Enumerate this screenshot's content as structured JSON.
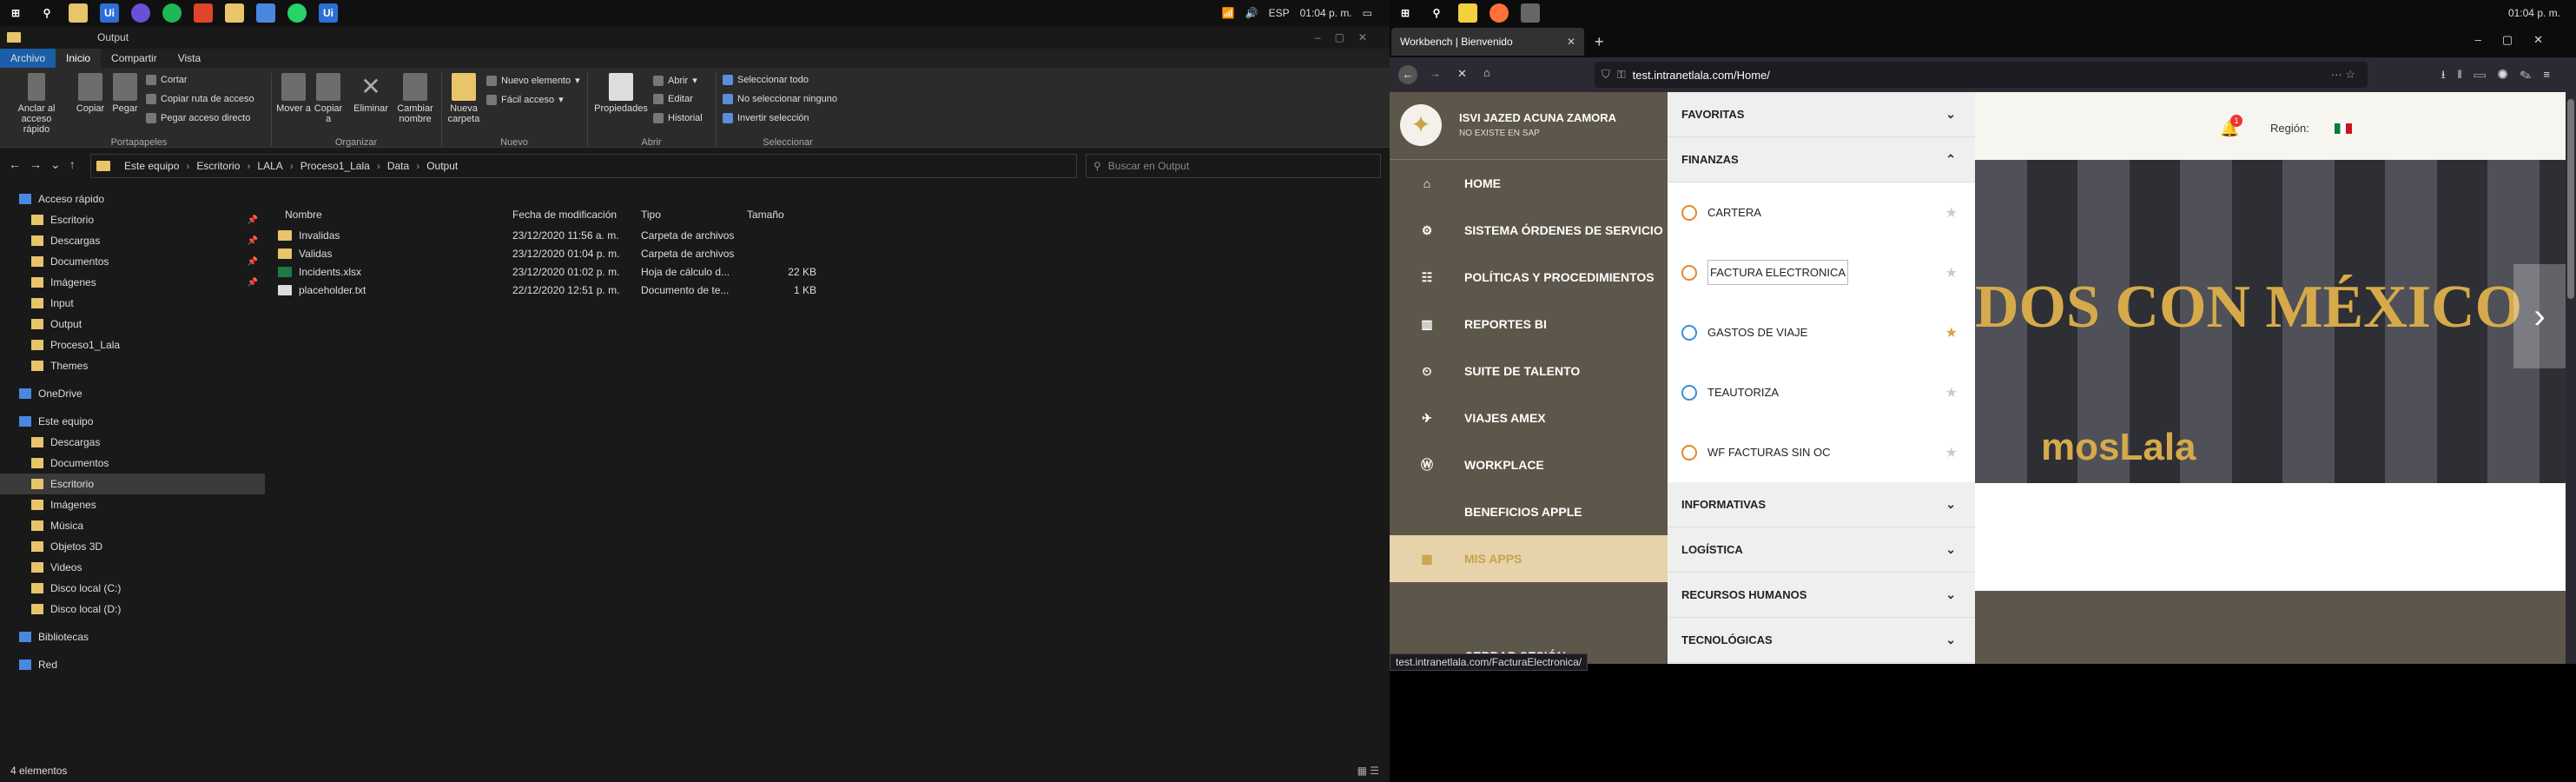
{
  "left_taskbar": {
    "time": "01:04 p. m.",
    "lang": "ESP"
  },
  "right_taskbar": {
    "time": "01:04 p. m."
  },
  "explorer": {
    "title": "Output",
    "tabs": [
      "Archivo",
      "Inicio",
      "Compartir",
      "Vista"
    ],
    "ribbon": {
      "pin": "Anclar al acceso rápido",
      "copy": "Copiar",
      "paste": "Pegar",
      "cut": "Cortar",
      "copy_path": "Copiar ruta de acceso",
      "paste_shortcut": "Pegar acceso directo",
      "move": "Mover a",
      "copy_to": "Copiar a",
      "delete": "Eliminar",
      "rename": "Cambiar nombre",
      "new_folder": "Nueva carpeta",
      "new_item": "Nuevo elemento",
      "easy_access": "Fácil acceso",
      "properties": "Propiedades",
      "open": "Abrir",
      "edit": "Editar",
      "history": "Historial",
      "select_all": "Seleccionar todo",
      "select_none": "No seleccionar ninguno",
      "invert": "Invertir selección",
      "groups": [
        "Portapapeles",
        "Organizar",
        "Nuevo",
        "Abrir",
        "Seleccionar"
      ]
    },
    "breadcrumb": [
      "Este equipo",
      "Escritorio",
      "LALA",
      "Proceso1_Lala",
      "Data",
      "Output"
    ],
    "search_placeholder": "Buscar en Output",
    "nav": [
      {
        "label": "Acceso rápido",
        "pinned": false,
        "indent": 1
      },
      {
        "label": "Escritorio",
        "pinned": true,
        "indent": 2
      },
      {
        "label": "Descargas",
        "pinned": true,
        "indent": 2
      },
      {
        "label": "Documentos",
        "pinned": true,
        "indent": 2
      },
      {
        "label": "Imágenes",
        "pinned": true,
        "indent": 2
      },
      {
        "label": "Input",
        "pinned": false,
        "indent": 2
      },
      {
        "label": "Output",
        "pinned": false,
        "indent": 2
      },
      {
        "label": "Proceso1_Lala",
        "pinned": false,
        "indent": 2
      },
      {
        "label": "Themes",
        "pinned": false,
        "indent": 2
      },
      {
        "label": "OneDrive",
        "pinned": false,
        "indent": 1
      },
      {
        "label": "Este equipo",
        "pinned": false,
        "indent": 1
      },
      {
        "label": "Descargas",
        "pinned": false,
        "indent": 2
      },
      {
        "label": "Documentos",
        "pinned": false,
        "indent": 2
      },
      {
        "label": "Escritorio",
        "pinned": false,
        "indent": 2
      },
      {
        "label": "Imágenes",
        "pinned": false,
        "indent": 2
      },
      {
        "label": "Música",
        "pinned": false,
        "indent": 2
      },
      {
        "label": "Objetos 3D",
        "pinned": false,
        "indent": 2
      },
      {
        "label": "Videos",
        "pinned": false,
        "indent": 2
      },
      {
        "label": "Disco local (C:)",
        "pinned": false,
        "indent": 2
      },
      {
        "label": "Disco local (D:)",
        "pinned": false,
        "indent": 2
      },
      {
        "label": "Bibliotecas",
        "pinned": false,
        "indent": 1
      },
      {
        "label": "Red",
        "pinned": false,
        "indent": 1
      }
    ],
    "columns": [
      "Nombre",
      "Fecha de modificación",
      "Tipo",
      "Tamaño"
    ],
    "files": [
      {
        "name": "Invalidas",
        "date": "23/12/2020 11:56 a. m.",
        "type": "Carpeta de archivos",
        "size": "",
        "kind": "folder"
      },
      {
        "name": "Validas",
        "date": "23/12/2020 01:04 p. m.",
        "type": "Carpeta de archivos",
        "size": "",
        "kind": "folder"
      },
      {
        "name": "Incidents.xlsx",
        "date": "23/12/2020 01:02 p. m.",
        "type": "Hoja de cálculo d...",
        "size": "22 KB",
        "kind": "xlsx"
      },
      {
        "name": "placeholder.txt",
        "date": "22/12/2020 12:51 p. m.",
        "type": "Documento de te...",
        "size": "1 KB",
        "kind": "txt"
      }
    ],
    "status": "4 elementos"
  },
  "firefox": {
    "tab_title": "Workbench | Bienvenido",
    "url": "test.intranetlala.com/Home/",
    "status_url": "test.intranetlala.com/FacturaElectronica/",
    "user_name": "ISVI JAZED ACUNA ZAMORA",
    "user_sub": "NO EXISTE EN SAP",
    "menu": [
      "HOME",
      "SISTEMA ÓRDENES DE SERVICIO",
      "POLÍTICAS Y PROCEDIMIENTOS",
      "REPORTES BI",
      "SUITE DE TALENTO",
      "VIAJES AMEX",
      "WORKPLACE",
      "BENEFICIOS APPLE",
      "MIS APPS",
      "CERRAR SESIÓN"
    ],
    "accordion_top": [
      "FAVORITAS",
      "FINANZAS"
    ],
    "finanzas_items": [
      {
        "label": "CARTERA",
        "fav": false
      },
      {
        "label": "FACTURA ELECTRONICA",
        "fav": false
      },
      {
        "label": "GASTOS DE VIAJE",
        "fav": true
      },
      {
        "label": "TEAUTORIZA",
        "fav": false
      },
      {
        "label": "WF FACTURAS SIN OC",
        "fav": false
      }
    ],
    "accordion_bottom": [
      "INFORMATIVAS",
      "LOGÍSTICA",
      "RECURSOS HUMANOS",
      "TECNOLÓGICAS"
    ],
    "region_label": "Región:",
    "notif_count": "1",
    "banner_text": "DOS CON MÉXICO",
    "banner_text2": "mosLala",
    "colors": {
      "sidebar": "#5d564a",
      "accent": "#c8a24a",
      "mis_apps_bg": "#e6d3aa"
    }
  }
}
